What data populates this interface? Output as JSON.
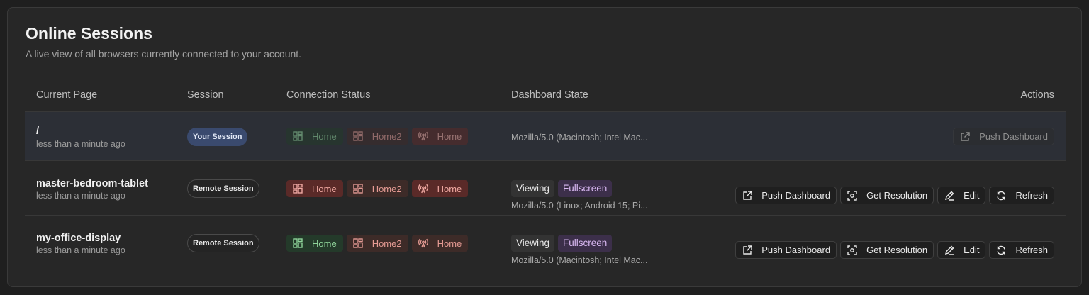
{
  "header": {
    "title": "Online Sessions",
    "subtitle": "A live view of all browsers currently connected to your account."
  },
  "columns": {
    "current_page": "Current Page",
    "session": "Session",
    "connection_status": "Connection Status",
    "dashboard_state": "Dashboard State",
    "actions": "Actions"
  },
  "rows": [
    {
      "page": "/",
      "time": "less than a minute ago",
      "session": "Your Session",
      "chips": [
        "Home",
        "Home2",
        "Home"
      ],
      "viewing": "",
      "fullscreen": "",
      "ua": "Mozilla/5.0 (Macintosh; Intel Mac...",
      "push": "Push Dashboard"
    },
    {
      "page": "master-bedroom-tablet",
      "time": "less than a minute ago",
      "session": "Remote Session",
      "chips": [
        "Home",
        "Home2",
        "Home"
      ],
      "viewing": "Viewing",
      "fullscreen": "Fullscreen",
      "ua": "Mozilla/5.0 (Linux; Android 15; Pi...",
      "push": "Push Dashboard",
      "resolution": "Get Resolution",
      "edit": "Edit",
      "refresh": "Refresh"
    },
    {
      "page": "my-office-display",
      "time": "less than a minute ago",
      "session": "Remote Session",
      "chips": [
        "Home",
        "Home2",
        "Home"
      ],
      "viewing": "Viewing",
      "fullscreen": "Fullscreen",
      "ua": "Mozilla/5.0 (Macintosh; Intel Mac...",
      "push": "Push Dashboard",
      "resolution": "Get Resolution",
      "edit": "Edit",
      "refresh": "Refresh"
    }
  ],
  "icons": {
    "dashboard": "dashboard-icon",
    "antenna": "antenna-icon",
    "external": "external-link-icon",
    "focus": "focus-icon",
    "pencil": "pencil-icon",
    "refresh": "refresh-icon"
  },
  "colors": {
    "your_session": "#3a4a6e",
    "green_chip": "#243a2a",
    "red_chip": "#5a2a28",
    "fullscreen_badge": "#3c2f4a"
  }
}
